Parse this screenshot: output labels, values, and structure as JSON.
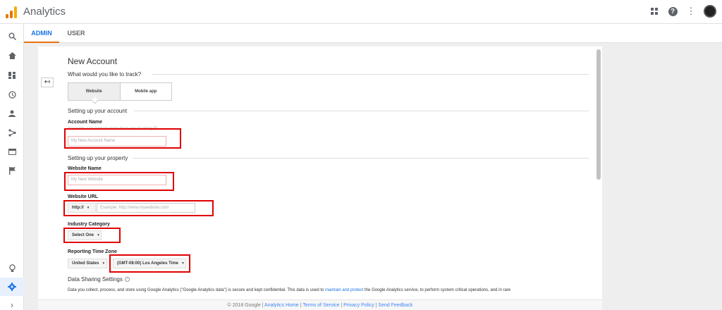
{
  "app": {
    "title": "Analytics"
  },
  "tabs": [
    {
      "label": "ADMIN"
    },
    {
      "label": "USER"
    }
  ],
  "form": {
    "title": "New Account",
    "track_question": "What would you like to track?",
    "track_options": [
      {
        "label": "Website"
      },
      {
        "label": "Mobile app"
      }
    ],
    "section_account": "Setting up your account",
    "account_name_label": "Account Name",
    "account_name_hint": "Accounts can contain more than one tracking ID.",
    "account_name_placeholder": "My New Account Name",
    "section_property": "Setting up your property",
    "website_name_label": "Website Name",
    "website_name_placeholder": "My New Website",
    "website_url_label": "Website URL",
    "protocol_value": "http://",
    "url_placeholder": "Example: http://www.mywebsite.com",
    "industry_label": "Industry Category",
    "industry_value": "Select One",
    "timezone_label": "Reporting Time Zone",
    "country_value": "United States",
    "timezone_value": "(GMT-08:00) Los Angeles Time",
    "data_sharing_title": "Data Sharing Settings",
    "data_sharing_text_1": "Data you collect, process, and store using Google Analytics (\"Google Analytics data\") is secure and kept confidential. This data is used to ",
    "data_sharing_link": "maintain and protect",
    "data_sharing_text_2": " the Google Analytics service, to perform system critical operations, and in rare"
  },
  "footer": {
    "copyright": "© 2018 Google | ",
    "links": [
      "Analytics Home",
      "Terms of Service",
      "Privacy Policy",
      "Send Feedback"
    ],
    "separator": " | "
  },
  "colors": {
    "accent": "#1a73e8",
    "tab_underline": "#e8710a",
    "annotation_red": "#e00000",
    "logo": [
      "#f9ab00",
      "#e37400",
      "#e37400"
    ]
  },
  "icons": {
    "rail": [
      "search-icon",
      "home-icon",
      "dashboard-icon",
      "clock-icon",
      "person-icon",
      "acquisition-icon",
      "behavior-icon",
      "flag-icon",
      "lightbulb-icon",
      "gear-icon",
      "chevron-right-icon"
    ],
    "top": [
      "apps-grid-icon",
      "help-icon",
      "more-vert-icon"
    ]
  }
}
